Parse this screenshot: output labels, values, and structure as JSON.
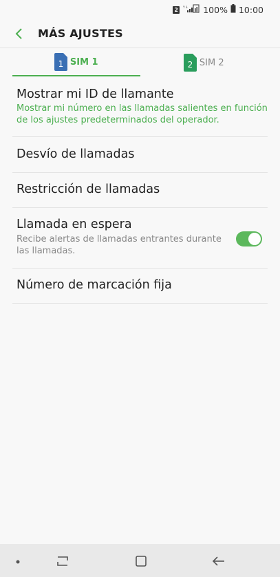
{
  "status_bar": {
    "sim_badge": "2",
    "battery_percent": "100%",
    "time": "10:00",
    "icons": [
      "sim-2-badge-icon",
      "signal-icon",
      "battery-icon"
    ]
  },
  "header": {
    "title": "MÁS AJUSTES",
    "back_icon": "back-chevron-icon"
  },
  "tabs": [
    {
      "sim_number": "1",
      "label": "SIM 1",
      "active": true,
      "color": "#3a6fb4"
    },
    {
      "sim_number": "2",
      "label": "SIM 2",
      "active": false,
      "color": "#2a9d5c"
    }
  ],
  "settings": {
    "caller_id": {
      "title": "Mostrar mi ID de llamante",
      "subtitle": "Mostrar mi número en las llamadas salientes en función de los ajustes predeterminados del operador."
    },
    "call_forwarding": {
      "title": "Desvío de llamadas"
    },
    "call_barring": {
      "title": "Restricción de llamadas"
    },
    "call_waiting": {
      "title": "Llamada en espera",
      "subtitle": "Recibe alertas de llamadas entrantes durante las llamadas.",
      "enabled": true
    },
    "fixed_dialing": {
      "title": "Número de marcación fija"
    }
  },
  "nav_bar": {
    "icons": [
      "dot-icon",
      "recent-apps-icon",
      "home-icon",
      "back-arrow-icon"
    ]
  },
  "colors": {
    "accent": "#4caf50",
    "background": "#f8f8f8",
    "divider": "#e4e4e4"
  }
}
